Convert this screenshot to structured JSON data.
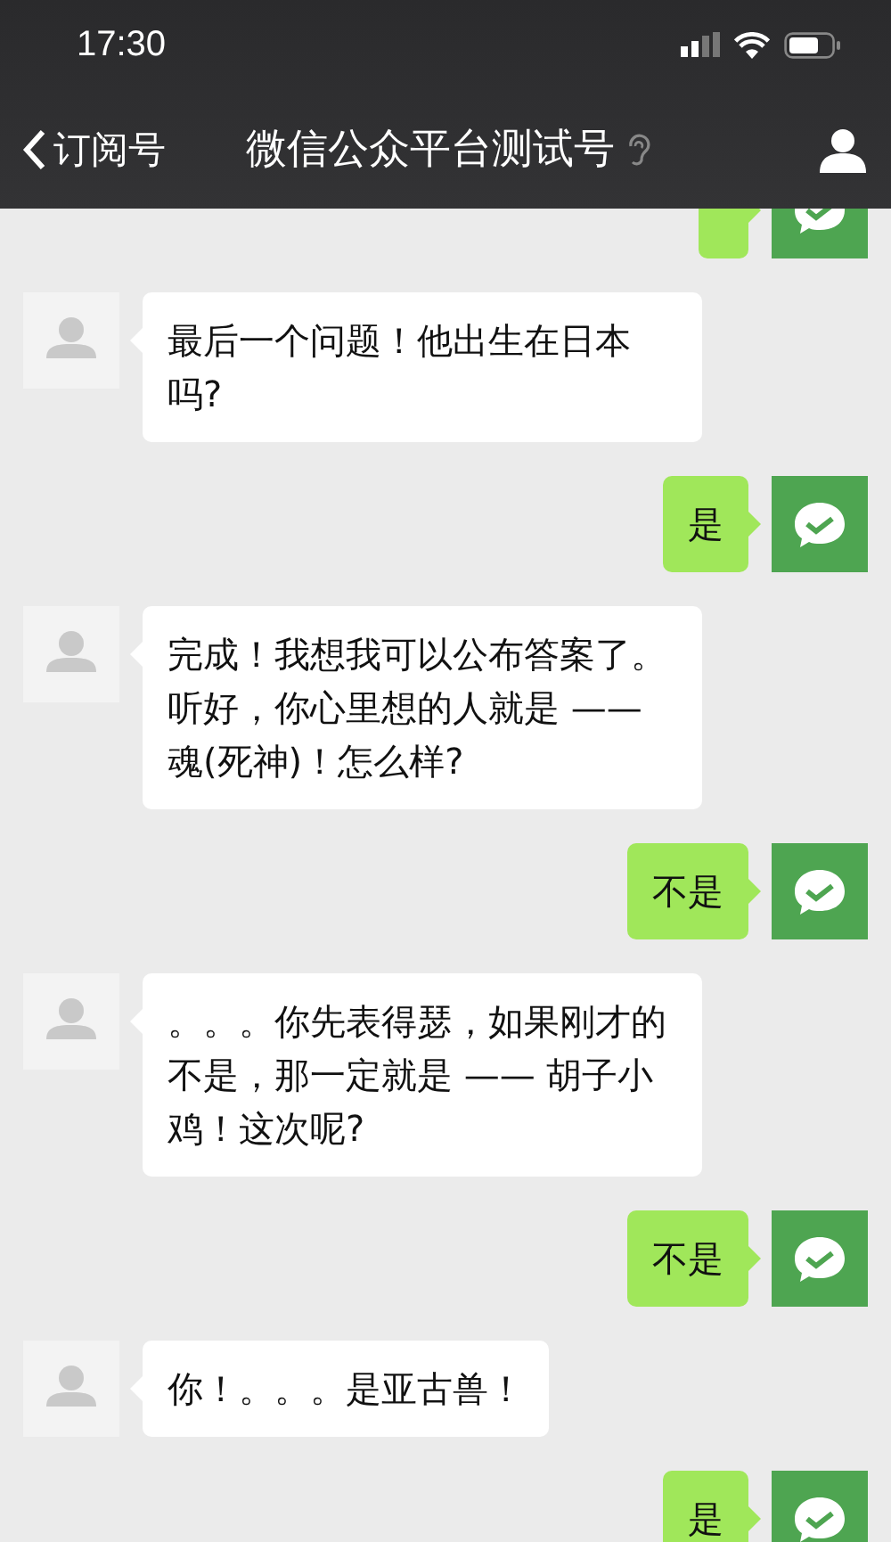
{
  "status_bar": {
    "time": "17:30"
  },
  "nav": {
    "back_label": "订阅号",
    "title": "微信公众平台测试号"
  },
  "messages": [
    {
      "kind": "outgoing"
    },
    {
      "kind": "incoming",
      "text": "最后一个问题！他出生在日本吗?"
    },
    {
      "kind": "outgoing",
      "text": "是"
    },
    {
      "kind": "incoming",
      "text": "完成！我想我可以公布答案了。听好，你心里想的人就是 —— 魂(死神)！怎么样?"
    },
    {
      "kind": "outgoing",
      "text": "不是"
    },
    {
      "kind": "incoming",
      "text": "。。。你先表得瑟，如果刚才的不是，那一定就是 —— 胡子小鸡！这次呢?"
    },
    {
      "kind": "outgoing",
      "text": "不是"
    },
    {
      "kind": "incoming",
      "text": "你！。。。是亚古兽！"
    },
    {
      "kind": "outgoing",
      "text": "是"
    }
  ]
}
